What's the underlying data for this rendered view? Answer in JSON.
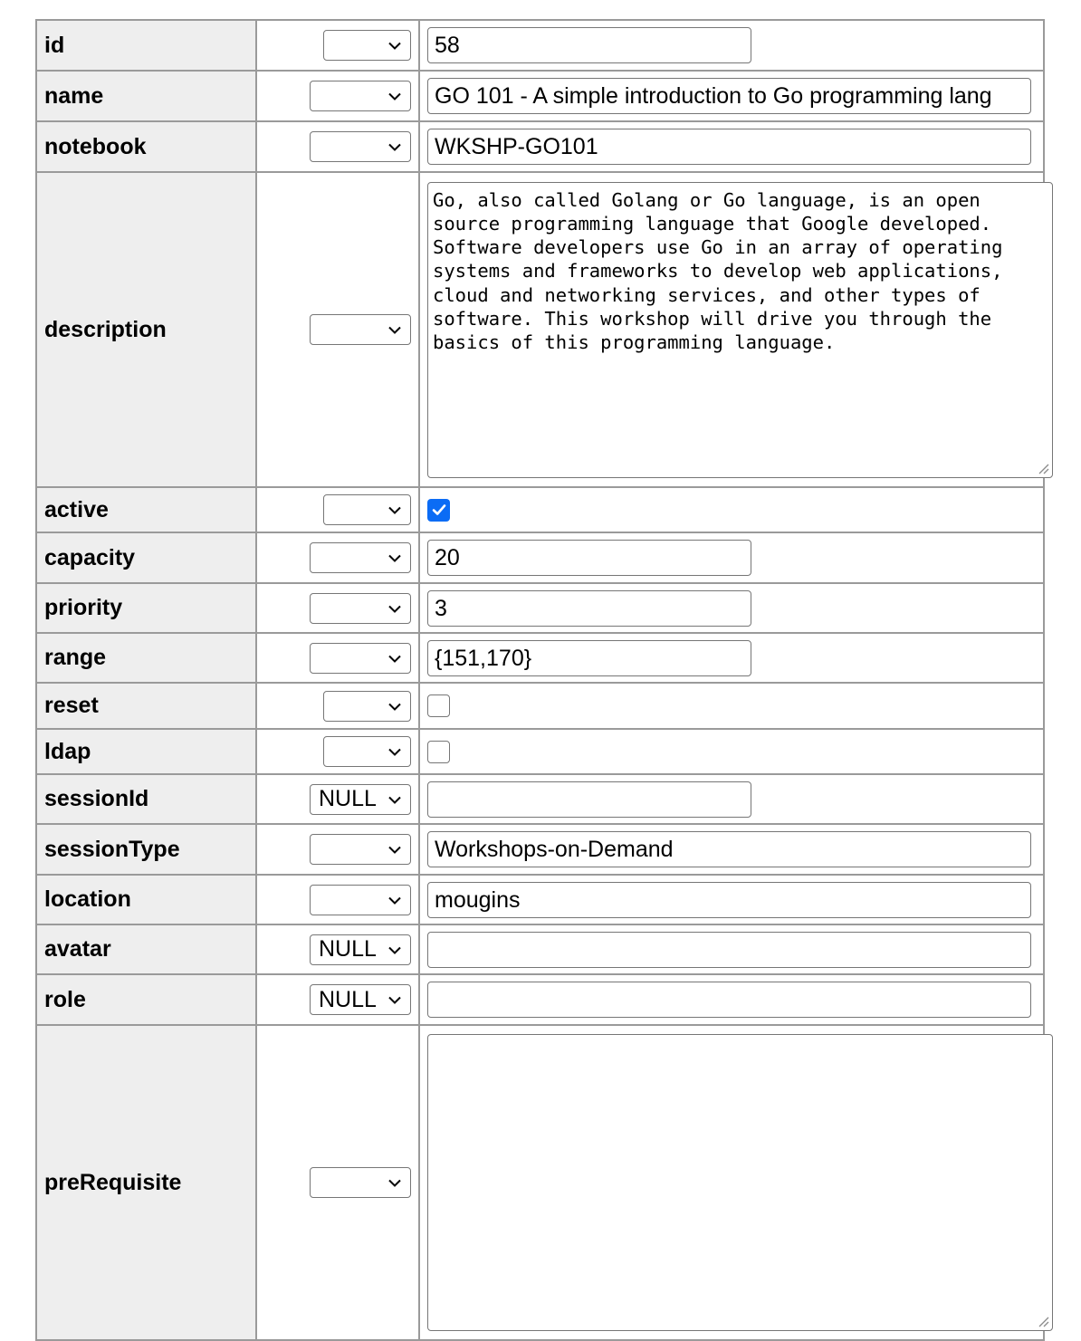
{
  "rows": [
    {
      "label": "id",
      "func": "",
      "type": "text",
      "value": "58"
    },
    {
      "label": "name",
      "func": "",
      "type": "text",
      "value": "GO 101 - A simple introduction to Go programming lang"
    },
    {
      "label": "notebook",
      "func": "",
      "type": "text",
      "value": "WKSHP-GO101"
    },
    {
      "label": "description",
      "func": "",
      "type": "textarea",
      "value": "Go, also called Golang or Go language, is an open source programming language that Google developed. Software developers use Go in an array of operating systems and frameworks to develop web applications, cloud and networking services, and other types of software. This workshop will drive you through the basics of this programming language."
    },
    {
      "label": "active",
      "func": "",
      "type": "checkbox",
      "checked": true
    },
    {
      "label": "capacity",
      "func": "",
      "type": "text",
      "value": "20"
    },
    {
      "label": "priority",
      "func": "",
      "type": "text",
      "value": "3"
    },
    {
      "label": "range",
      "func": "",
      "type": "text",
      "value": "{151,170}"
    },
    {
      "label": "reset",
      "func": "",
      "type": "checkbox",
      "checked": false
    },
    {
      "label": "ldap",
      "func": "",
      "type": "checkbox",
      "checked": false
    },
    {
      "label": "sessionId",
      "func": "NULL",
      "type": "text",
      "value": ""
    },
    {
      "label": "sessionType",
      "func": "",
      "type": "text",
      "value": "Workshops-on-Demand"
    },
    {
      "label": "location",
      "func": "",
      "type": "text",
      "value": "mougins"
    },
    {
      "label": "avatar",
      "func": "NULL",
      "type": "text",
      "value": ""
    },
    {
      "label": "role",
      "func": "NULL",
      "type": "text",
      "value": ""
    },
    {
      "label": "preRequisite",
      "func": "",
      "type": "textarea",
      "value": ""
    }
  ],
  "colors": {
    "checkbox_checked": "#0b6cf5",
    "label_background": "#eeeeee",
    "border": "#9a9a9a"
  },
  "icons": {
    "select_arrow": "chevron-down-icon",
    "checkmark": "checkmark-icon",
    "resize": "resize-grip-icon"
  }
}
